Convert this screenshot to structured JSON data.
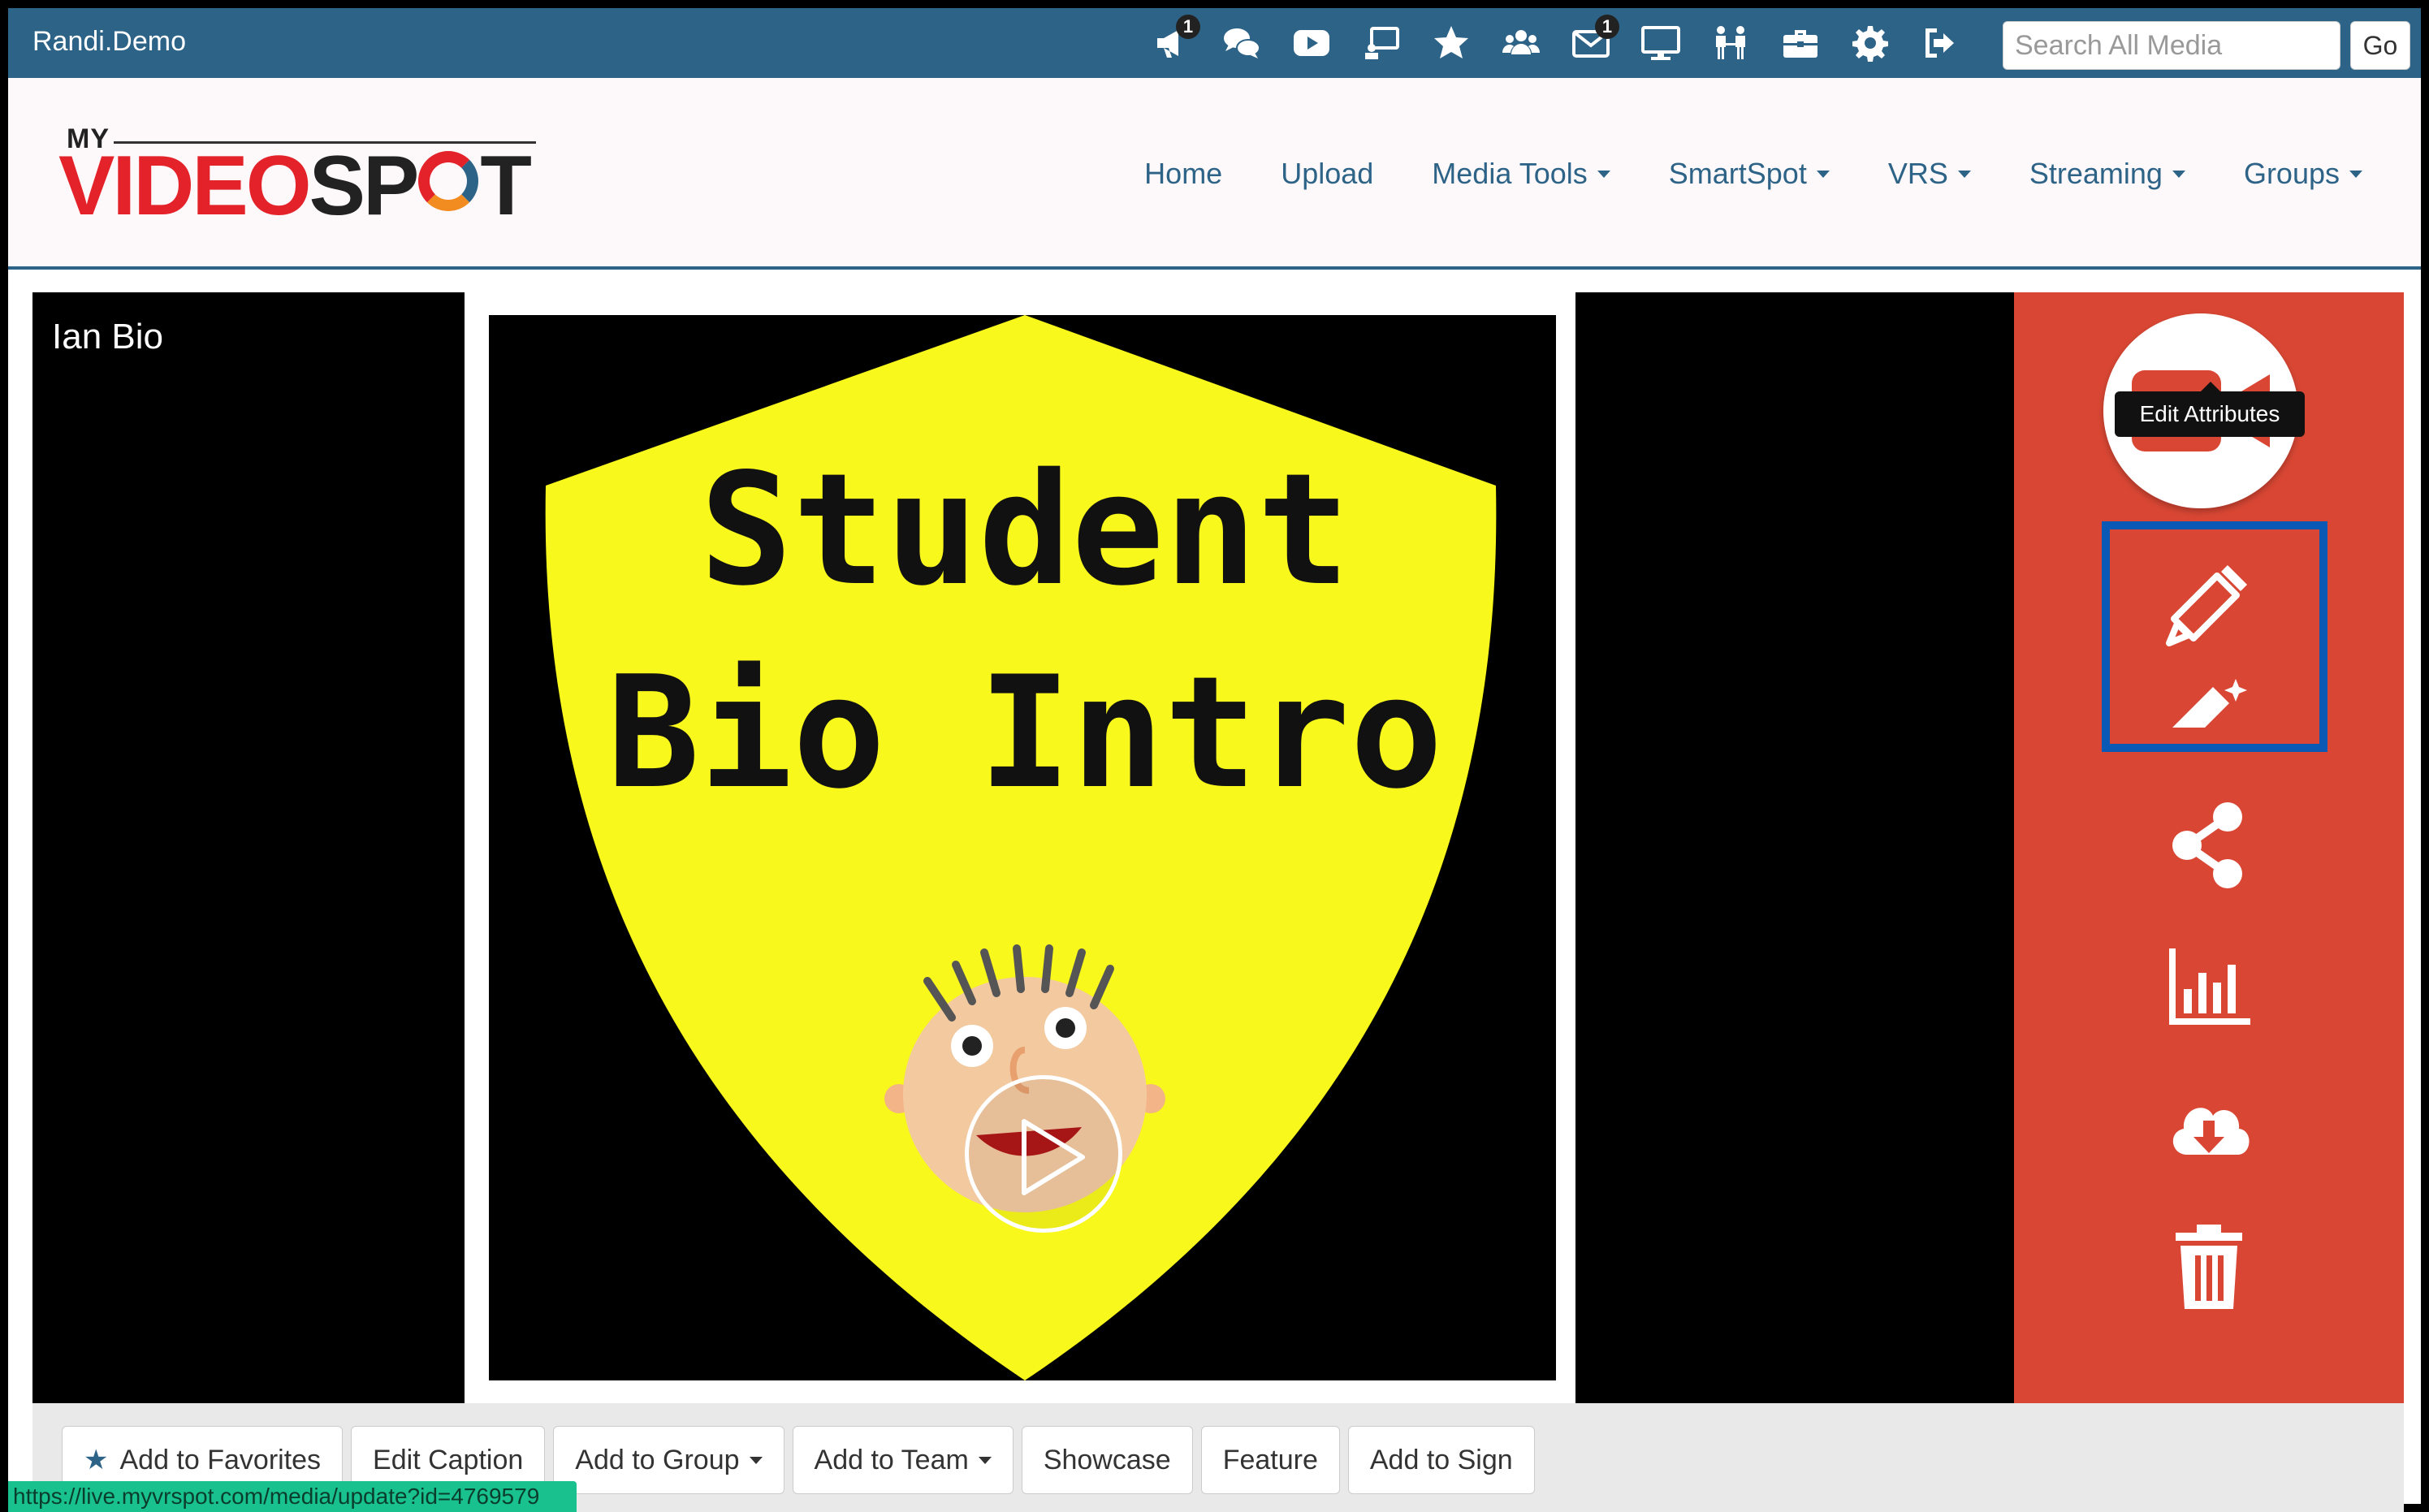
{
  "topbar": {
    "user": "Randi.Demo",
    "icons": [
      {
        "name": "megaphone-icon",
        "badge": "1"
      },
      {
        "name": "chat-icon",
        "badge": ""
      },
      {
        "name": "youtube-icon",
        "badge": ""
      },
      {
        "name": "presenter-icon",
        "badge": ""
      },
      {
        "name": "star-icon",
        "badge": ""
      },
      {
        "name": "users-icon",
        "badge": ""
      },
      {
        "name": "mail-icon",
        "badge": "1"
      },
      {
        "name": "monitor-icon",
        "badge": ""
      },
      {
        "name": "meeting-icon",
        "badge": ""
      },
      {
        "name": "toolbox-icon",
        "badge": ""
      },
      {
        "name": "gear-icon",
        "badge": ""
      },
      {
        "name": "sign-out-icon",
        "badge": ""
      }
    ],
    "search_placeholder": "Search All Media",
    "go_label": "Go"
  },
  "header": {
    "logo": {
      "my": "MY",
      "video": "VIDEO",
      "sp": "SP",
      "t": "T"
    },
    "nav": [
      {
        "label": "Home",
        "dropdown": false
      },
      {
        "label": "Upload",
        "dropdown": false
      },
      {
        "label": "Media Tools",
        "dropdown": true
      },
      {
        "label": "SmartSpot",
        "dropdown": true
      },
      {
        "label": "VRS",
        "dropdown": true
      },
      {
        "label": "Streaming",
        "dropdown": true
      },
      {
        "label": "Groups",
        "dropdown": true
      }
    ]
  },
  "player": {
    "title": "Ian Bio",
    "thumbnail_text": [
      "Student",
      "Bio Intro"
    ]
  },
  "side_panel": {
    "color": "#d94734",
    "actions": [
      "record-video-icon",
      "pencil-icon",
      "magic-wand-icon",
      "share-icon",
      "analytics-icon",
      "cloud-download-icon",
      "trash-icon"
    ],
    "tooltip": "Edit Attributes",
    "highlight_color": "#0a5ab5"
  },
  "buttons": {
    "favorites": "Add to Favorites",
    "caption": "Edit Caption",
    "group": "Add to Group",
    "team": "Add to Team",
    "showcase": "Showcase",
    "feature": "Feature",
    "sign": "Add to Sign"
  },
  "status_url": "https://live.myvrspot.com/media/update?id=4769579"
}
